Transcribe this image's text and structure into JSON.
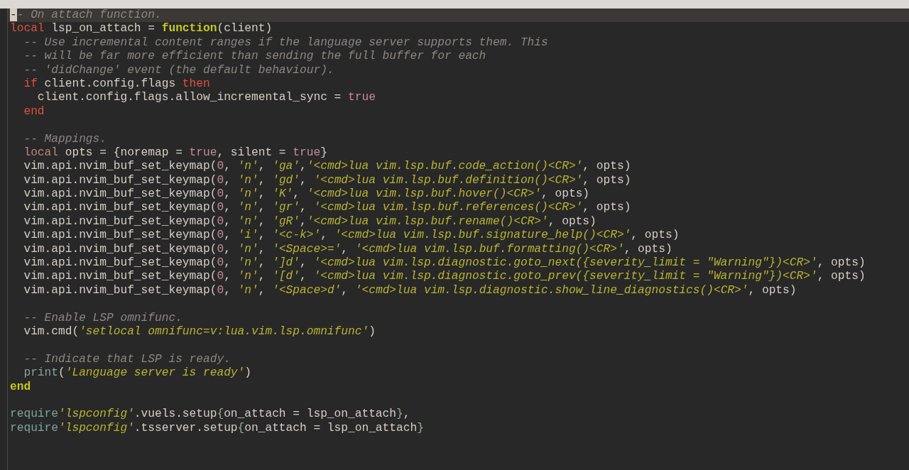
{
  "blocks": [
    {
      "lines": [
        {
          "current": true,
          "tokens": [
            {
              "kind": "cursor",
              "text": "-"
            },
            {
              "kind": "comment",
              "text": "- On attach function."
            }
          ]
        },
        {
          "current": false,
          "tokens": [
            {
              "kind": "keyword",
              "text": "local"
            },
            {
              "kind": "plain",
              "text": " lsp_on_attach = "
            },
            {
              "kind": "function",
              "text": "function"
            },
            {
              "kind": "plain",
              "text": "(client)"
            }
          ]
        },
        {
          "current": false,
          "tokens": [
            {
              "kind": "comment",
              "text": "  -- Use incremental content ranges if the language server supports them. This"
            }
          ]
        },
        {
          "current": false,
          "tokens": [
            {
              "kind": "comment",
              "text": "  -- will be far more efficient than sending the full buffer for each"
            }
          ]
        },
        {
          "current": false,
          "tokens": [
            {
              "kind": "comment",
              "text": "  -- 'didChange' event (the default behaviour)."
            }
          ]
        },
        {
          "current": false,
          "tokens": [
            {
              "kind": "keyword",
              "text": "  if"
            },
            {
              "kind": "plain",
              "text": " client.config.flags "
            },
            {
              "kind": "keyword",
              "text": "then"
            }
          ]
        },
        {
          "current": false,
          "tokens": [
            {
              "kind": "plain",
              "text": "    client.config.flags.allow_incremental_sync = "
            },
            {
              "kind": "boolean",
              "text": "true"
            }
          ]
        },
        {
          "current": false,
          "tokens": [
            {
              "kind": "keyword",
              "text": "  end"
            }
          ]
        }
      ]
    },
    {
      "lines": [
        {
          "current": false,
          "tokens": [
            {
              "kind": "comment",
              "text": "  -- Mappings."
            }
          ]
        },
        {
          "current": false,
          "tokens": [
            {
              "kind": "local",
              "text": "  local"
            },
            {
              "kind": "plain",
              "text": " opts = {noremap = "
            },
            {
              "kind": "boolean",
              "text": "true"
            },
            {
              "kind": "plain",
              "text": ", silent = "
            },
            {
              "kind": "boolean",
              "text": "true"
            },
            {
              "kind": "plain",
              "text": "}"
            }
          ]
        },
        {
          "current": false,
          "tokens": [
            {
              "kind": "plain",
              "text": "  vim.api.nvim_buf_set_keymap("
            },
            {
              "kind": "boolean",
              "text": "0"
            },
            {
              "kind": "plain",
              "text": ", "
            },
            {
              "kind": "string",
              "text": "'n'"
            },
            {
              "kind": "plain",
              "text": ", "
            },
            {
              "kind": "string",
              "text": "'ga'"
            },
            {
              "kind": "plain",
              "text": ","
            },
            {
              "kind": "string",
              "text": "'<cmd>lua vim.lsp.buf.code_action()<CR>'"
            },
            {
              "kind": "plain",
              "text": ", opts)"
            }
          ]
        },
        {
          "current": false,
          "tokens": [
            {
              "kind": "plain",
              "text": "  vim.api.nvim_buf_set_keymap("
            },
            {
              "kind": "boolean",
              "text": "0"
            },
            {
              "kind": "plain",
              "text": ", "
            },
            {
              "kind": "string",
              "text": "'n'"
            },
            {
              "kind": "plain",
              "text": ", "
            },
            {
              "kind": "string",
              "text": "'gd'"
            },
            {
              "kind": "plain",
              "text": ", "
            },
            {
              "kind": "string",
              "text": "'<cmd>lua vim.lsp.buf.definition()<CR>'"
            },
            {
              "kind": "plain",
              "text": ", opts)"
            }
          ]
        },
        {
          "current": false,
          "tokens": [
            {
              "kind": "plain",
              "text": "  vim.api.nvim_buf_set_keymap("
            },
            {
              "kind": "boolean",
              "text": "0"
            },
            {
              "kind": "plain",
              "text": ", "
            },
            {
              "kind": "string",
              "text": "'n'"
            },
            {
              "kind": "plain",
              "text": ", "
            },
            {
              "kind": "string",
              "text": "'K'"
            },
            {
              "kind": "plain",
              "text": ", "
            },
            {
              "kind": "string",
              "text": "'<cmd>lua vim.lsp.buf.hover()<CR>'"
            },
            {
              "kind": "plain",
              "text": ", opts)"
            }
          ]
        },
        {
          "current": false,
          "tokens": [
            {
              "kind": "plain",
              "text": "  vim.api.nvim_buf_set_keymap("
            },
            {
              "kind": "boolean",
              "text": "0"
            },
            {
              "kind": "plain",
              "text": ", "
            },
            {
              "kind": "string",
              "text": "'n'"
            },
            {
              "kind": "plain",
              "text": ", "
            },
            {
              "kind": "string",
              "text": "'gr'"
            },
            {
              "kind": "plain",
              "text": ", "
            },
            {
              "kind": "string",
              "text": "'<cmd>lua vim.lsp.buf.references()<CR>'"
            },
            {
              "kind": "plain",
              "text": ", opts)"
            }
          ]
        },
        {
          "current": false,
          "tokens": [
            {
              "kind": "plain",
              "text": "  vim.api.nvim_buf_set_keymap("
            },
            {
              "kind": "boolean",
              "text": "0"
            },
            {
              "kind": "plain",
              "text": ", "
            },
            {
              "kind": "string",
              "text": "'n'"
            },
            {
              "kind": "plain",
              "text": ", "
            },
            {
              "kind": "string",
              "text": "'gR'"
            },
            {
              "kind": "plain",
              "text": ","
            },
            {
              "kind": "string",
              "text": "'<cmd>lua vim.lsp.buf.rename()<CR>'"
            },
            {
              "kind": "plain",
              "text": ", opts)"
            }
          ]
        },
        {
          "current": false,
          "tokens": [
            {
              "kind": "plain",
              "text": "  vim.api.nvim_buf_set_keymap("
            },
            {
              "kind": "boolean",
              "text": "0"
            },
            {
              "kind": "plain",
              "text": ", "
            },
            {
              "kind": "string",
              "text": "'i'"
            },
            {
              "kind": "plain",
              "text": ", "
            },
            {
              "kind": "string",
              "text": "'<c-k>'"
            },
            {
              "kind": "plain",
              "text": ", "
            },
            {
              "kind": "string",
              "text": "'<cmd>lua vim.lsp.buf.signature_help()<CR>'"
            },
            {
              "kind": "plain",
              "text": ", opts)"
            }
          ]
        },
        {
          "current": false,
          "tokens": [
            {
              "kind": "plain",
              "text": "  vim.api.nvim_buf_set_keymap("
            },
            {
              "kind": "boolean",
              "text": "0"
            },
            {
              "kind": "plain",
              "text": ", "
            },
            {
              "kind": "string",
              "text": "'n'"
            },
            {
              "kind": "plain",
              "text": ", "
            },
            {
              "kind": "string",
              "text": "'<Space>='"
            },
            {
              "kind": "plain",
              "text": ", "
            },
            {
              "kind": "string",
              "text": "'<cmd>lua vim.lsp.buf.formatting()<CR>'"
            },
            {
              "kind": "plain",
              "text": ", opts)"
            }
          ]
        },
        {
          "current": false,
          "tokens": [
            {
              "kind": "plain",
              "text": "  vim.api.nvim_buf_set_keymap("
            },
            {
              "kind": "boolean",
              "text": "0"
            },
            {
              "kind": "plain",
              "text": ", "
            },
            {
              "kind": "string",
              "text": "'n'"
            },
            {
              "kind": "plain",
              "text": ", "
            },
            {
              "kind": "string",
              "text": "']d'"
            },
            {
              "kind": "plain",
              "text": ", "
            },
            {
              "kind": "string",
              "text": "'<cmd>lua vim.lsp.diagnostic.goto_next({severity_limit = \"Warning\"})<CR>'"
            },
            {
              "kind": "plain",
              "text": ", opts)"
            }
          ]
        },
        {
          "current": false,
          "tokens": [
            {
              "kind": "plain",
              "text": "  vim.api.nvim_buf_set_keymap("
            },
            {
              "kind": "boolean",
              "text": "0"
            },
            {
              "kind": "plain",
              "text": ", "
            },
            {
              "kind": "string",
              "text": "'n'"
            },
            {
              "kind": "plain",
              "text": ", "
            },
            {
              "kind": "string",
              "text": "'[d'"
            },
            {
              "kind": "plain",
              "text": ", "
            },
            {
              "kind": "string",
              "text": "'<cmd>lua vim.lsp.diagnostic.goto_prev({severity_limit = \"Warning\"})<CR>'"
            },
            {
              "kind": "plain",
              "text": ", opts)"
            }
          ]
        },
        {
          "current": false,
          "tokens": [
            {
              "kind": "plain",
              "text": "  vim.api.nvim_buf_set_keymap("
            },
            {
              "kind": "boolean",
              "text": "0"
            },
            {
              "kind": "plain",
              "text": ", "
            },
            {
              "kind": "string",
              "text": "'n'"
            },
            {
              "kind": "plain",
              "text": ", "
            },
            {
              "kind": "string",
              "text": "'<Space>d'"
            },
            {
              "kind": "plain",
              "text": ", "
            },
            {
              "kind": "string",
              "text": "'<cmd>lua vim.lsp.diagnostic.show_line_diagnostics()<CR>'"
            },
            {
              "kind": "plain",
              "text": ", opts)"
            }
          ]
        }
      ]
    },
    {
      "lines": [
        {
          "current": false,
          "tokens": [
            {
              "kind": "comment",
              "text": "  -- Enable LSP omnifunc."
            }
          ]
        },
        {
          "current": false,
          "tokens": [
            {
              "kind": "plain",
              "text": "  vim.cmd("
            },
            {
              "kind": "string",
              "text": "'setlocal omnifunc=v:lua.vim.lsp.omnifunc'"
            },
            {
              "kind": "plain",
              "text": ")"
            }
          ]
        }
      ]
    },
    {
      "lines": [
        {
          "current": false,
          "tokens": [
            {
              "kind": "comment",
              "text": "  -- Indicate that LSP is ready."
            }
          ]
        },
        {
          "current": false,
          "tokens": [
            {
              "kind": "builtin",
              "text": "  print"
            },
            {
              "kind": "plain",
              "text": "("
            },
            {
              "kind": "string",
              "text": "'Language server is ready'"
            },
            {
              "kind": "plain",
              "text": ")"
            }
          ]
        },
        {
          "current": false,
          "tokens": [
            {
              "kind": "function",
              "text": "end"
            }
          ]
        }
      ]
    },
    {
      "lines": [
        {
          "current": false,
          "tokens": [
            {
              "kind": "builtin",
              "text": "require"
            },
            {
              "kind": "string",
              "text": "'lspconfig'"
            },
            {
              "kind": "plain",
              "text": ".vuels.setup"
            },
            {
              "kind": "brace",
              "text": "{"
            },
            {
              "kind": "plain",
              "text": "on_attach = lsp_on_attach"
            },
            {
              "kind": "brace",
              "text": "}"
            },
            {
              "kind": "plain",
              "text": ","
            }
          ]
        },
        {
          "current": false,
          "tokens": [
            {
              "kind": "builtin",
              "text": "require"
            },
            {
              "kind": "string",
              "text": "'lspconfig'"
            },
            {
              "kind": "plain",
              "text": ".tsserver.setup"
            },
            {
              "kind": "brace",
              "text": "{"
            },
            {
              "kind": "plain",
              "text": "on_attach = lsp_on_attach"
            },
            {
              "kind": "brace",
              "text": "}"
            }
          ]
        }
      ]
    }
  ]
}
